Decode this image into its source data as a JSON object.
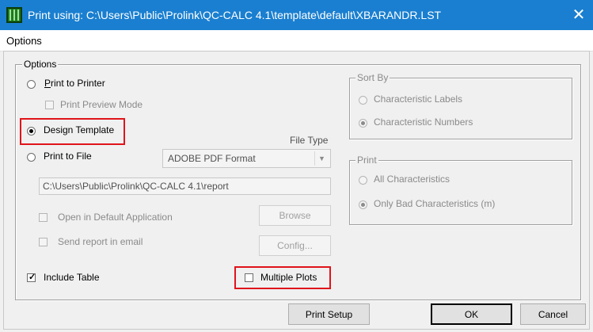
{
  "window": {
    "title": "Print using: C:\\Users\\Public\\Prolink\\QC-CALC 4.1\\template\\default\\XBARANDR.LST",
    "close_glyph": "✕",
    "icon": "qc-calc-app-icon"
  },
  "menu": {
    "options_label": "Options"
  },
  "options_group": {
    "legend": "Options",
    "print_to_printer": {
      "label": "Print to Printer",
      "accel": "P",
      "selected": false
    },
    "print_preview": {
      "label": "Print Preview Mode",
      "checked": false,
      "enabled": false
    },
    "design_template": {
      "label": "Design Template",
      "selected": true
    },
    "print_to_file": {
      "label": "Print to File",
      "selected": false
    },
    "file_type_label": "File Type",
    "file_type_value": "ADOBE PDF Format",
    "file_path": "C:\\Users\\Public\\Prolink\\QC-CALC 4.1\\report",
    "open_default_app": {
      "label": "Open in Default Application",
      "checked": false,
      "enabled": false
    },
    "send_email": {
      "label": "Send report in email",
      "checked": false,
      "enabled": false
    },
    "browse_button": "Browse",
    "config_button": "Config...",
    "include_table": {
      "label": "Include Table",
      "checked": true
    },
    "multiple_plots": {
      "label": "Multiple Plots",
      "checked": false
    }
  },
  "sort_by_group": {
    "legend": "Sort By",
    "char_labels": {
      "label": "Characteristic Labels",
      "selected": false
    },
    "char_numbers": {
      "label": "Characteristic Numbers",
      "selected": true
    }
  },
  "print_group": {
    "legend": "Print",
    "all_chars": {
      "label": "All Characteristics",
      "selected": false
    },
    "only_bad": {
      "label": "Only Bad Characteristics (m)",
      "selected": true
    }
  },
  "buttons": {
    "print_setup": "Print Setup",
    "ok": "OK",
    "cancel": "Cancel"
  },
  "colors": {
    "titlebar": "#1a7fd0",
    "highlight_box": "#e0141a",
    "dialog_bg": "#f0f0f0"
  }
}
